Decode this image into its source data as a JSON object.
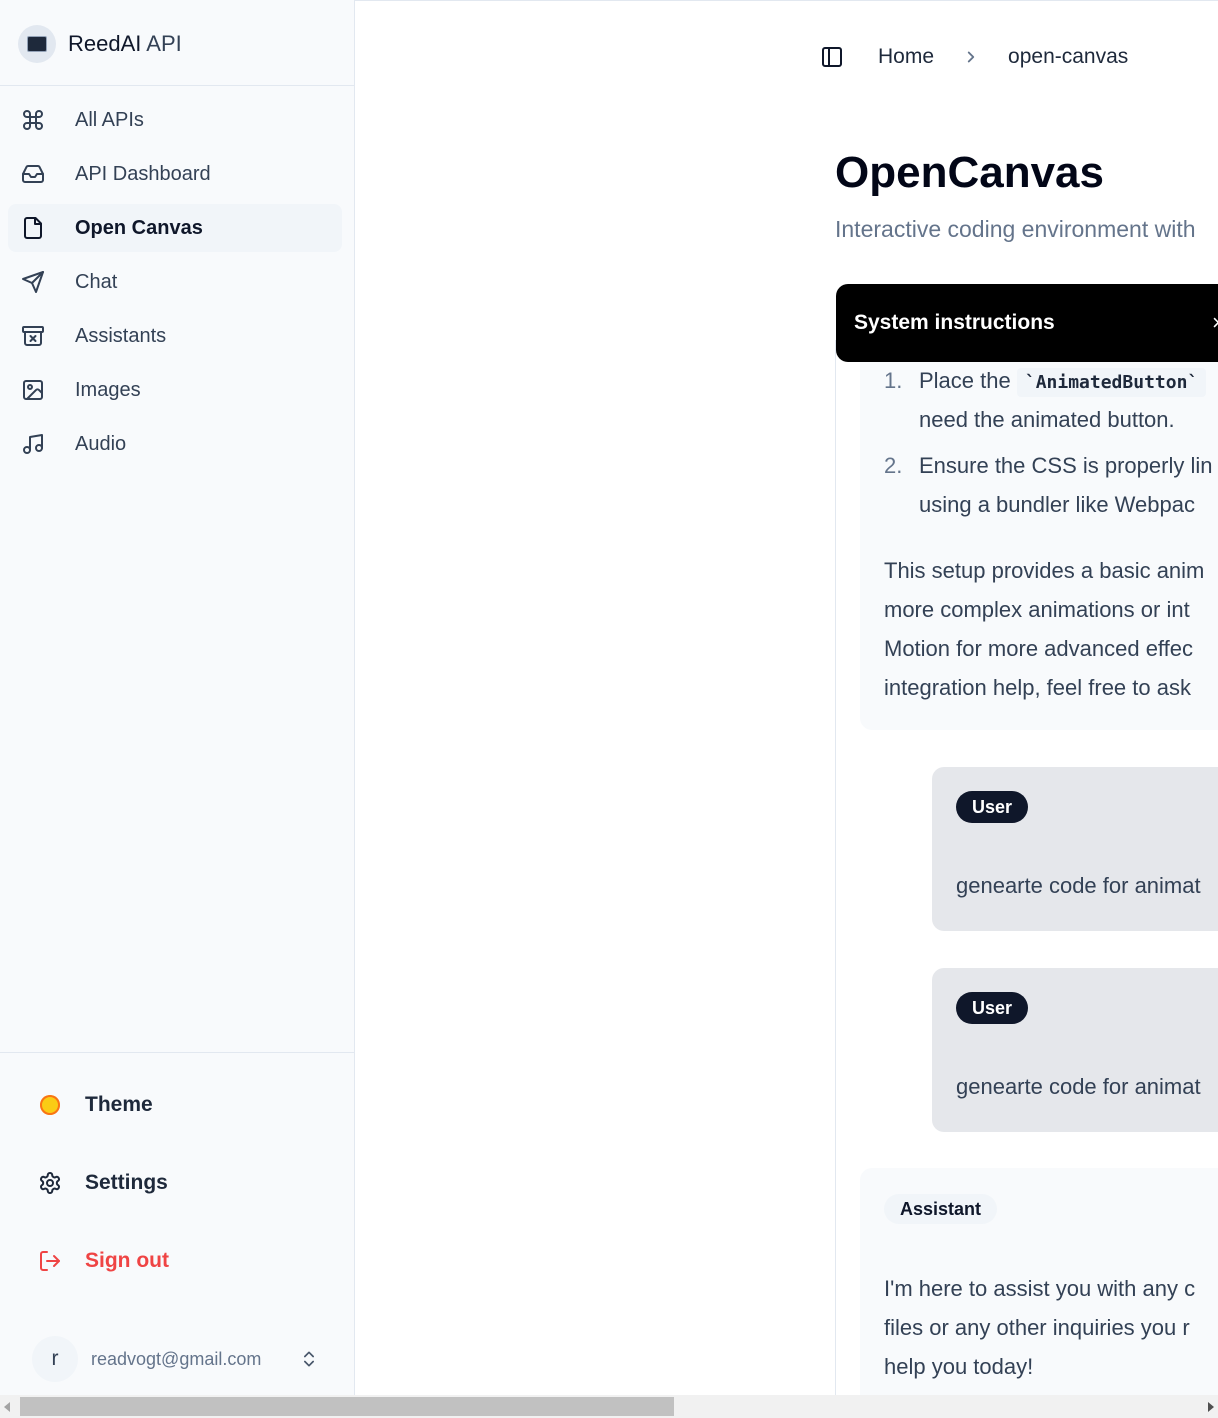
{
  "brand": {
    "name": "ReedAI",
    "suffix": "API"
  },
  "sidebar": {
    "items": [
      {
        "label": "All APIs",
        "icon": "command-icon"
      },
      {
        "label": "API Dashboard",
        "icon": "inbox-icon"
      },
      {
        "label": "Open Canvas",
        "icon": "file-icon",
        "active": true
      },
      {
        "label": "Chat",
        "icon": "send-icon"
      },
      {
        "label": "Assistants",
        "icon": "archive-x-icon"
      },
      {
        "label": "Images",
        "icon": "image-icon"
      },
      {
        "label": "Audio",
        "icon": "music-icon"
      }
    ],
    "theme_label": "Theme",
    "settings_label": "Settings",
    "signout_label": "Sign out",
    "user": {
      "initial": "r",
      "email": "readvogt@gmail.com"
    }
  },
  "breadcrumb": {
    "home": "Home",
    "current": "open-canvas"
  },
  "page": {
    "title": "OpenCanvas",
    "subtitle": "Interactive coding environment with"
  },
  "system_instructions": {
    "label": "System instructions",
    "close_glyph": "×"
  },
  "assistant_message": {
    "list": [
      {
        "num": "1.",
        "line1_pre": "Place the",
        "code": "`AnimatedButton`",
        "line2": "need the animated button."
      },
      {
        "num": "2.",
        "line1": "Ensure the CSS is properly lin",
        "line2": "using a bundler like Webpac"
      }
    ],
    "paragraph": [
      "This setup provides a basic anim",
      "more complex animations or int",
      "Motion for more advanced effec",
      "integration help, feel free to ask"
    ]
  },
  "user_messages": [
    {
      "role": "User",
      "text": "genearte code for animat"
    },
    {
      "role": "User",
      "text": "genearte code for animat"
    }
  ],
  "assistant_message_2": {
    "role": "Assistant",
    "lines": [
      "I'm here to assist you with any c",
      "files or any other inquiries you r",
      "help you today!"
    ]
  },
  "colors": {
    "accent": "#0f172a",
    "signout": "#ef4444",
    "sidebar_bg": "#f8fafc"
  }
}
